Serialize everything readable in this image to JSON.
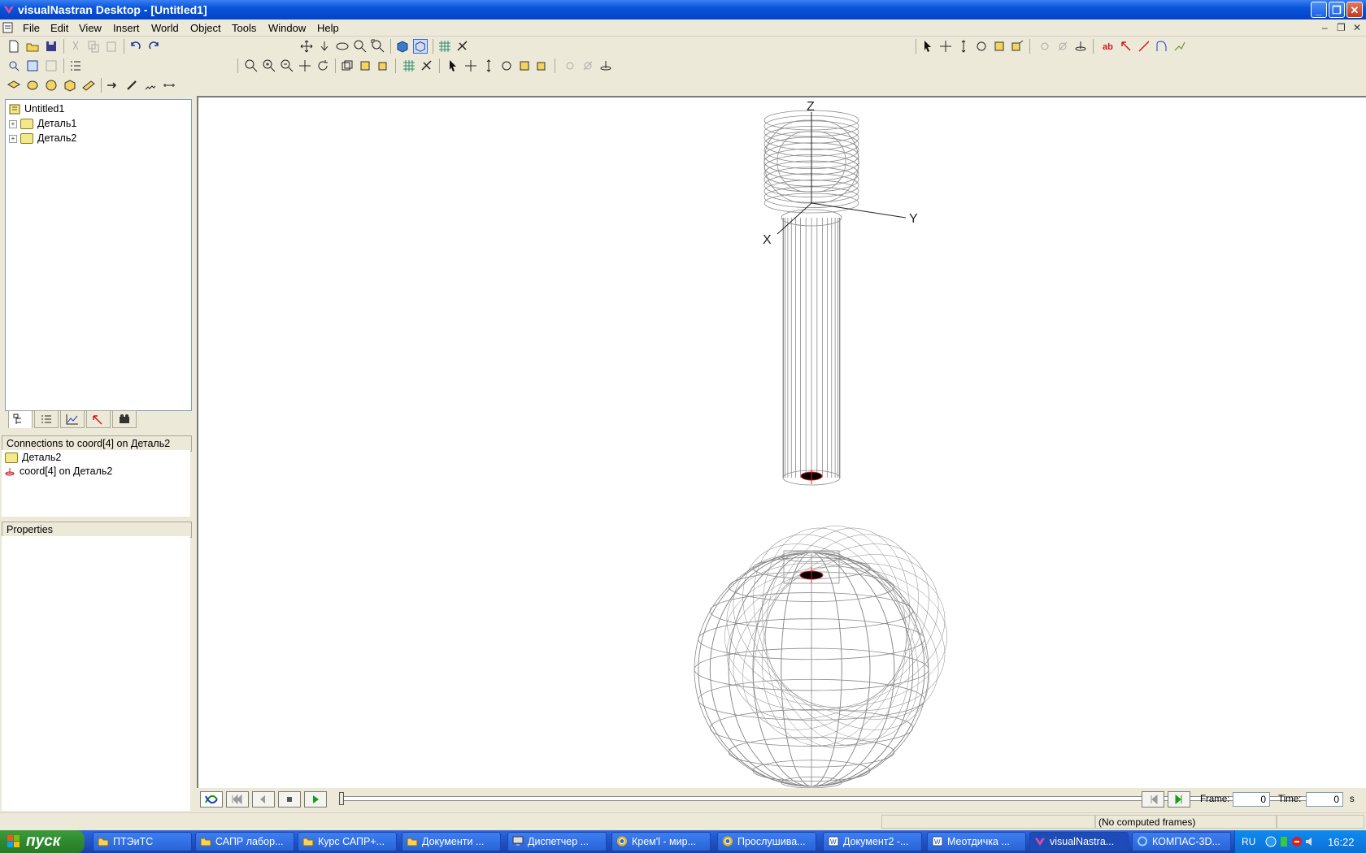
{
  "window": {
    "title": "visualNastran Desktop - [Untitled1]",
    "controls": [
      "minimize",
      "restore",
      "close"
    ]
  },
  "menu": [
    "File",
    "Edit",
    "View",
    "Insert",
    "World",
    "Object",
    "Tools",
    "Window",
    "Help"
  ],
  "tree": {
    "root": "Untitled1",
    "items": [
      {
        "label": "Деталь1"
      },
      {
        "label": "Деталь2"
      }
    ]
  },
  "tabs": [
    "tree-icon",
    "list-icon",
    "graph-icon",
    "coord-icon",
    "camera-icon"
  ],
  "connections": {
    "header": "Connections to coord[4] on Деталь2",
    "items": [
      {
        "label": "Деталь2",
        "icon": "folder-icon"
      },
      {
        "label": "coord[4] on Деталь2",
        "icon": "coord-icon"
      }
    ]
  },
  "properties": {
    "header": "Properties"
  },
  "viewport": {
    "axes": {
      "z": "Z",
      "y": "Y",
      "x": "X"
    },
    "wire_color": "#8a8a8a",
    "marker_color": "#e02020"
  },
  "playback": {
    "frame_label": "Frame:",
    "frame_value": "0",
    "time_label": "Time:",
    "time_value": "0",
    "time_unit": "s"
  },
  "status": {
    "computed": "(No computed frames)"
  },
  "taskbar": {
    "start": "пуск",
    "tasks": [
      {
        "label": "ПТЭиТС",
        "icon": "folder-icon"
      },
      {
        "label": "САПР лабор...",
        "icon": "folder-icon"
      },
      {
        "label": "Курс САПР+...",
        "icon": "folder-icon"
      },
      {
        "label": "Документи ...",
        "icon": "folder-icon"
      },
      {
        "label": "Диспетчер ...",
        "icon": "monitor-icon"
      },
      {
        "label": "Крем'l - мир...",
        "icon": "chrome-icon"
      },
      {
        "label": "Прослушива...",
        "icon": "chrome-icon"
      },
      {
        "label": "Документ2 -...",
        "icon": "word-icon"
      },
      {
        "label": "Меотдичка ...",
        "icon": "word-icon"
      },
      {
        "label": "visualNastra...",
        "icon": "vn-icon",
        "active": true
      },
      {
        "label": "КОМПАС-3D...",
        "icon": "kompas-icon"
      }
    ],
    "lang": "RU",
    "clock": "16:22"
  }
}
